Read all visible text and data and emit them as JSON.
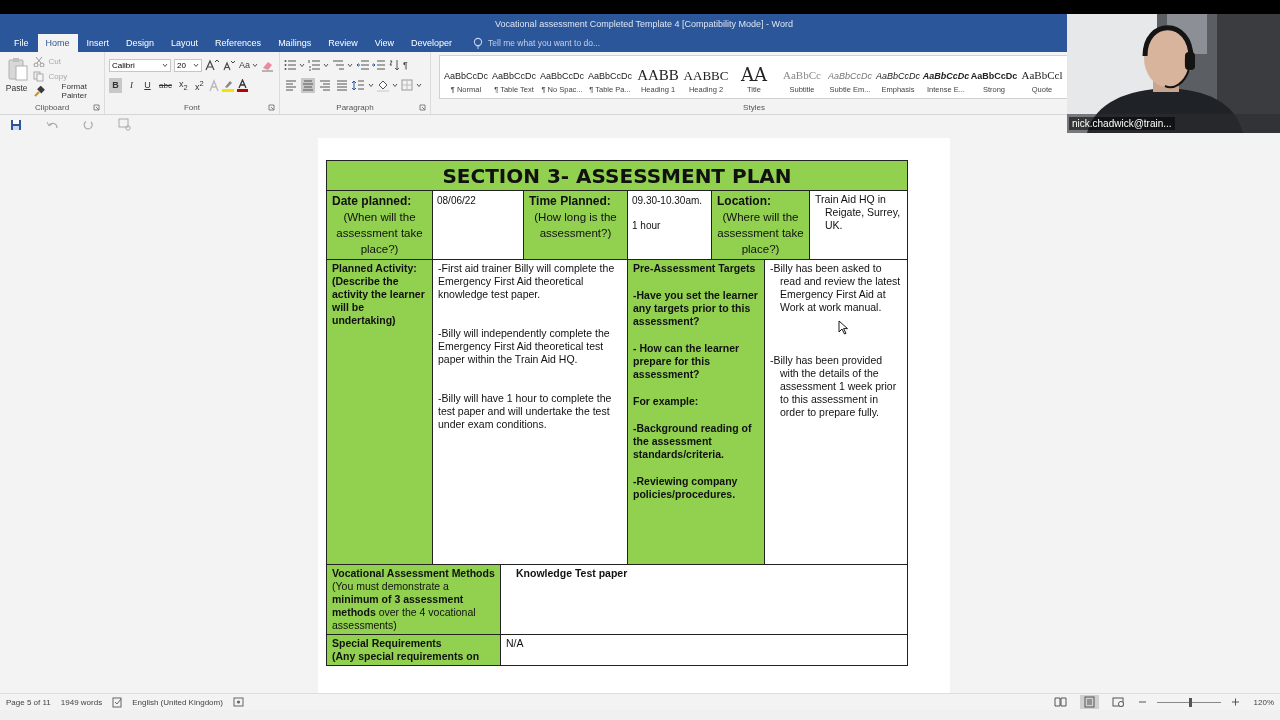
{
  "window": {
    "title": "Vocational assessment Completed Template 4 [Compatibility Mode] - Word"
  },
  "tabs": [
    {
      "label": "File",
      "selected": false
    },
    {
      "label": "Home",
      "selected": true
    },
    {
      "label": "Insert",
      "selected": false
    },
    {
      "label": "Design",
      "selected": false
    },
    {
      "label": "Layout",
      "selected": false
    },
    {
      "label": "References",
      "selected": false
    },
    {
      "label": "Mailings",
      "selected": false
    },
    {
      "label": "Review",
      "selected": false
    },
    {
      "label": "View",
      "selected": false
    },
    {
      "label": "Developer",
      "selected": false
    }
  ],
  "tell_me": {
    "placeholder": "Tell me what you want to do..."
  },
  "clipboard": {
    "label": "Clipboard",
    "paste": "Paste",
    "commands": [
      {
        "label": "Cut",
        "disabled": true
      },
      {
        "label": "Copy",
        "disabled": true
      },
      {
        "label": "Format Painter",
        "disabled": false
      }
    ]
  },
  "font": {
    "label": "Font",
    "name": "Calibri",
    "size": "20",
    "case_button": "Aa",
    "format_buttons": [
      {
        "label": "B",
        "selected": true
      },
      {
        "label": "I",
        "selected": false
      },
      {
        "label": "U",
        "selected": false
      },
      {
        "label": "abc",
        "selected": false
      },
      {
        "label": "x$_{2}$",
        "selected": false
      },
      {
        "label": "x$^{2}$",
        "selected": false
      }
    ]
  },
  "paragraph": {
    "label": "Paragraph",
    "marks_button": "¶",
    "alignment": [
      {
        "selected": false
      },
      {
        "selected": true
      },
      {
        "selected": false
      },
      {
        "selected": false
      }
    ]
  },
  "styles": {
    "label": "Styles",
    "items": [
      {
        "kind": "normal",
        "preview": "AaBbCcDc",
        "name": "¶ Normal"
      },
      {
        "kind": "normal",
        "preview": "AaBbCcDc",
        "name": "¶ Table Text"
      },
      {
        "kind": "normal",
        "preview": "AaBbCcDc",
        "name": "¶ No Spac..."
      },
      {
        "kind": "normal",
        "preview": "AaBbCcDc",
        "name": "¶ Table Pa..."
      },
      {
        "kind": "heading",
        "preview": "AABB",
        "name": "Heading 1"
      },
      {
        "kind": "heading2",
        "preview": "AABBC",
        "name": "Heading 2"
      },
      {
        "kind": "title",
        "preview": "AA",
        "name": "Title"
      },
      {
        "kind": "subtitle",
        "preview": "AaBbCc",
        "name": "Subtitle"
      },
      {
        "kind": "subtle",
        "preview": "AaBbCcDc",
        "name": "Subtle Em..."
      },
      {
        "kind": "emphasis",
        "preview": "AaBbCcDc",
        "name": "Emphasis"
      },
      {
        "kind": "intense",
        "preview": "AaBbCcDc",
        "name": "Intense E..."
      },
      {
        "kind": "strong",
        "preview": "AaBbCcDc",
        "name": "Strong"
      },
      {
        "kind": "quote",
        "preview": "AaBbCcl",
        "name": "Quote"
      }
    ]
  },
  "document": {
    "title": "SECTION 3- ASSESSMENT PLAN",
    "rows": [
      {
        "kind": "info",
        "cells": [
          {
            "kind": "label",
            "heading": "Date planned:",
            "paragraphs": [
              "(When will the assessment take place?)"
            ]
          },
          {
            "kind": "value",
            "colspan": 2,
            "paragraphs": [
              "08/06/22"
            ]
          },
          {
            "kind": "label",
            "heading": "Time Planned:",
            "paragraphs": [
              "(How long is the assessment?)"
            ]
          },
          {
            "kind": "value",
            "paragraphs": [
              "09.30-10.30am.",
              "1 hour"
            ]
          },
          {
            "kind": "label",
            "colspan": 2,
            "heading": "Location:",
            "paragraphs": [
              "(Where will the assessment take place?)"
            ]
          },
          {
            "kind": "value-hanging",
            "paragraphs": [
              "Train Aid HQ in Reigate, Surrey, UK."
            ]
          }
        ]
      },
      {
        "kind": "activity",
        "cells": [
          {
            "kind": "label-bold",
            "heading": "Planned Activity:",
            "paragraphs": [
              "(Describe the activity the learner will be undertaking)"
            ]
          },
          {
            "kind": "value",
            "colspan": 3,
            "paragraphs": [
              "-First aid trainer Billy will complete the Emergency First Aid theoretical knowledge test paper.",
              "-Billy will independently complete the Emergency First Aid theoretical test paper within the Train Aid HQ.",
              "-Billy will have 1 hour to complete the test paper and will undertake the test under exam conditions."
            ]
          },
          {
            "kind": "label-bold",
            "colspan": 2,
            "heading": "Pre-Assessment Targets",
            "paragraphs": [
              "-Have you set the learner any targets prior to this assessment?",
              "- How can the learner prepare for this assessment?",
              "For example:",
              "-Background reading of the assessment standards/criteria.",
              "-Reviewing company policies/procedures."
            ]
          },
          {
            "kind": "value-hanging",
            "colspan": 2,
            "paragraphs": [
              "-Billy has been asked to read and review the latest Emergency First Aid at Work at work manual.",
              "-Billy has been provided with the details of the assessment 1 week prior to this assessment in order to prepare fully."
            ]
          }
        ]
      },
      {
        "kind": "wide",
        "cells": [
          {
            "kind": "label",
            "colspan": 2,
            "heading": "Vocational Assessment Methods",
            "paragraphs": [
              "(You must demonstrate a **minimum of 3 assessment methods** over the 4 vocational assessments)"
            ]
          },
          {
            "kind": "value-bold",
            "colspan": 6,
            "paragraphs": [
              "Knowledge Test paper"
            ]
          }
        ]
      },
      {
        "kind": "wide",
        "cells": [
          {
            "kind": "label-bold",
            "colspan": 2,
            "heading": "Special Requirements",
            "paragraphs": [
              "(Any special requirements on"
            ]
          },
          {
            "kind": "value",
            "colspan": 6,
            "paragraphs": [
              "N/A"
            ]
          }
        ]
      }
    ]
  },
  "status_bar": {
    "page": "Page 5 of 11",
    "words": "1949 words",
    "language": "English (United Kingdom)",
    "views": [
      {
        "selected": false
      },
      {
        "selected": true
      },
      {
        "selected": false
      }
    ],
    "zoom": {
      "level": 0.52,
      "reading": "120%"
    }
  },
  "webcam": {
    "kind": "picture",
    "name": "nick.chadwick@train..."
  }
}
